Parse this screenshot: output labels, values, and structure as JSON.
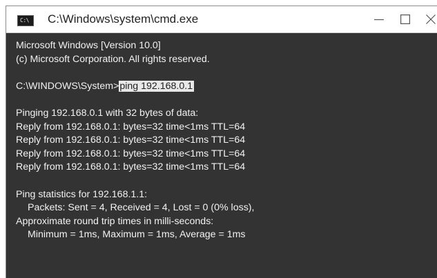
{
  "window": {
    "title": "C:\\Windows\\system\\cmd.exe",
    "icon": "cmd-icon",
    "icon_glyph": "C:\\",
    "controls": [
      "minimize-icon",
      "maximize-icon",
      "close-icon"
    ]
  },
  "console": {
    "header": [
      "Microsoft Windows [Version 10.0]",
      "(c) Microsoft Corporation. All rights reserved."
    ],
    "prompt": "C:\\WINDOWS\\System>",
    "command": "ping 192.168.0.1",
    "ping_header": "Pinging 192.168.0.1 with 32 bytes of data:",
    "replies": [
      "Reply from 192.168.0.1: bytes=32 time<1ms TTL=64",
      "Reply from 192.168.0.1: bytes=32 time<1ms TTL=64",
      "Reply from 192.168.0.1: bytes=32 time<1ms TTL=64",
      "Reply from 192.168.0.1: bytes=32 time<1ms TTL=64"
    ],
    "stats_header": "Ping statistics for 192.168.1.1:",
    "packets": "Packets: Sent = 4, Received = 4, Lost = 0 (0% loss),",
    "rtt_header": "Approximate round trip times in milli-seconds:",
    "rtt_values": "Minimum = 1ms, Maximum = 1ms, Average = 1ms"
  },
  "colors": {
    "console_bg": "#333333",
    "console_text": "#f2f2f2",
    "selection_bg": "#e8e8e8",
    "titlebar_bg": "#ffffff"
  }
}
